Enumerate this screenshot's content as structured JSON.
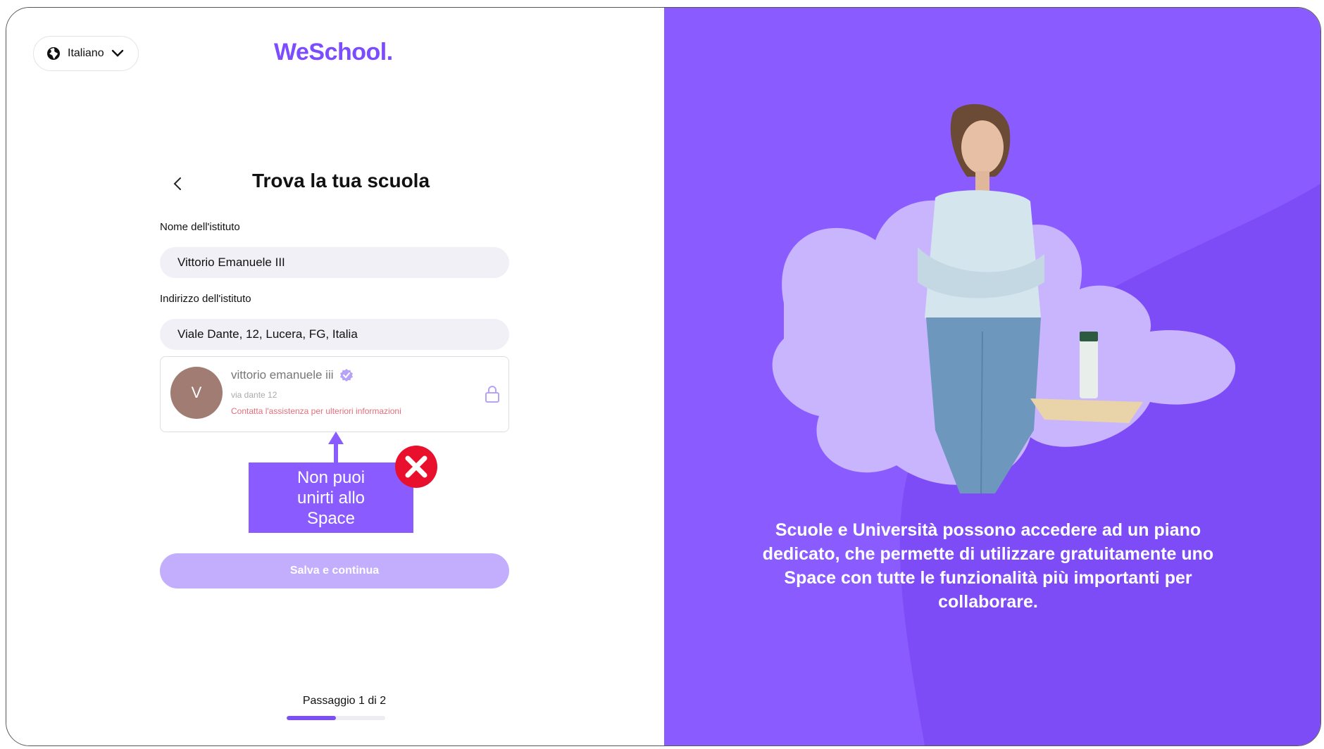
{
  "language": {
    "selected": "Italiano"
  },
  "brand": {
    "logo": "WeSchool"
  },
  "form": {
    "title": "Trova la tua scuola",
    "institute_name_label": "Nome dell'istituto",
    "institute_name_value": "Vittorio Emanuele III",
    "institute_address_label": "Indirizzo dell'istituto",
    "institute_address_value": "Viale Dante, 12, Lucera, FG, Italia",
    "submit_label": "Salva e continua"
  },
  "result_card": {
    "avatar_initial": "V",
    "name": "vittorio emanuele iii",
    "address": "via dante 12",
    "warning": "Contatta l'assistenza per ulteriori informazioni"
  },
  "annotation": {
    "text": "Non puoi unirti allo Space"
  },
  "stepper": {
    "label": "Passaggio 1 di 2",
    "progress": 0.5
  },
  "promo": {
    "text": "Scuole e Università possono accedere ad un piano dedicato, che permette di utilizzare gratuitamente uno Space con tutte le funzionalità più importanti per collaborare."
  },
  "colors": {
    "brand": "#7b4dff",
    "panel": "#8a5cff",
    "warning": "#e0707a",
    "error_badge": "#e8102c"
  }
}
